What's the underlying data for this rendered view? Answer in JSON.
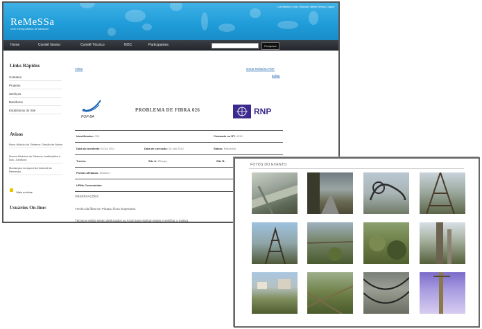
{
  "site": {
    "logo": "ReMeSSa",
    "logo_sub": "rede metropolitana de salvador",
    "top_links": "Luiz Barreto | Início | Manual | Alterar Senha | Logout"
  },
  "nav": {
    "items": [
      "Home",
      "Comitê Gestor",
      "Comitê Técnico",
      "NOC",
      "Participantes"
    ],
    "search_placeholder": "",
    "search_button": "Pesquisar"
  },
  "sidebar": {
    "quick_title": "Links Rápidos",
    "quick_links": [
      "Contatos",
      "Projetos",
      "Serviços",
      "Backbone",
      "Estatísticas do Site"
    ],
    "notices_title": "Avisos",
    "notices": [
      "Novo Módulo do Sistema: Gestão de Ativos",
      "Novos Módulos do Sistema: Instituições e Doc. Jurídicos",
      "Mudanças no layout da Intranet da Remessa"
    ],
    "more_news": "Mais notícias",
    "online_title": "Usuários On-line:"
  },
  "content": {
    "back_link": "Voltar",
    "pdf_link": "Gerar Relatório PDF",
    "edit_link": "Editar",
    "popba_logo": "POP-BA",
    "rnp_logo": "RNP",
    "title": "PROBLEMA DE FIBRA 026",
    "fields": {
      "identificador_label": "Identificador:",
      "identificador_value": "026",
      "chamado_label": "Chamado no RT:",
      "chamado_value": "4919",
      "incidente_label": "Data do Incidente:",
      "incidente_value": "5 Out 2011",
      "correcao_label": "Data de correção:",
      "correcao_value": "25 Jan 2012",
      "status_label": "Status:",
      "status_value": "Resolvido",
      "trecho_label": "Trecho:",
      "sitea_label": "Site A:",
      "sitea_value": "Pituaçu",
      "siteb_label": "Site B:",
      "pontos_label": "Pontos afetados:",
      "pontos_value": "Nenhum",
      "upms_label": "UPMs Consumidas:"
    },
    "observations_title": "OBSERVAÇÕES",
    "observations": [
      "Trecho da fibra em Pituaçu ficou inoperante.",
      "Técnicos estão sendo deslocados ao local para realizar testes e verificar o motivo."
    ]
  },
  "photos": {
    "title": "FOTOS DO EVENTO",
    "count": 12
  },
  "colors": {
    "header_blue": "#1e9bd8",
    "nav_dark": "#2b2f35",
    "link_blue": "#2767b0",
    "rnp_purple": "#3d2a8e"
  }
}
